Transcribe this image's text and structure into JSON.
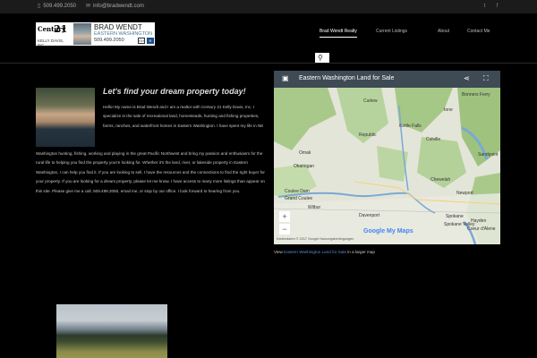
{
  "topbar": {
    "phone": "509.499.2050",
    "email": "info@bradwendt.com",
    "social": [
      {
        "icon": "twitter-icon",
        "glyph": "t"
      },
      {
        "icon": "facebook-icon",
        "glyph": "f"
      }
    ]
  },
  "logo": {
    "brand_word": "Century",
    "brand_num": "21",
    "brand_sub": "KELLY DAVIS, INC",
    "agent_name": "BRAD WENDT",
    "region": "EASTERN WASHINGTON",
    "phone": "509.499.2050",
    "equal_housing": "EH",
    "mls": "R"
  },
  "nav": {
    "items": [
      {
        "label": "Brad Wendt Realty",
        "active": true
      },
      {
        "label": "Current Listings",
        "active": false
      },
      {
        "label": "About",
        "active": false
      },
      {
        "label": "Contact Me",
        "active": false
      }
    ]
  },
  "main": {
    "heading": "Let's find your dream property today!",
    "bio_top": "Hello! My name is Brad Wendt and I am a realtor with Century 21 Kelly Davis, Inc. I specialize in the sale of recreational land, homesteads, hunting and fishing properties, farms, ranches, and waterfront homes in Eastern Washington. I have spent my life in NE",
    "bio_bottom": "Washington hunting, fishing, working and playing in the great Pacific Northwest and bring my passion and enthusiasm for the rural life to helping you find the property you're looking for. Whether it's the land, river, or lakeside property in Eastern Washington, I can help you find it. If you are looking to sell, I have the resources and the connections to find the right buyer for your property. If you are looking for a dream property, please let me know. I have access to many more listings than appear on this site. Please give me a call, 509.499.2050, email me, or stop by our office. I look forward to hearing from you."
  },
  "map": {
    "title": "Eastern Washington Land for Sale",
    "labels": [
      "Spokane",
      "Spokane Valley",
      "Coeur d'Alene",
      "Sandpoint",
      "Colville",
      "Chewelah",
      "Omak",
      "Okanogan",
      "Newport",
      "Coulee Dam",
      "Davenport",
      "Wilbur",
      "Grand Coulee",
      "Hayden",
      "Kettle Falls",
      "Curlew",
      "Republic",
      "Ione",
      "Bonners Ferry"
    ],
    "zoom_in": "+",
    "zoom_out": "−",
    "google": "Google My Maps",
    "attribution": "Kartendaten © 2017 Google  Nutzungsbedingungen"
  },
  "view_line": {
    "prefix": "View ",
    "link": "Eastern Washington Land for Sale",
    "suffix": " in a larger map"
  }
}
